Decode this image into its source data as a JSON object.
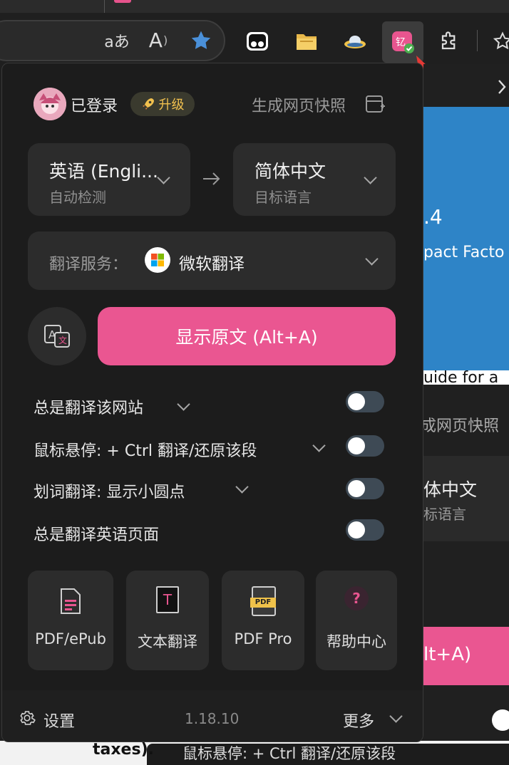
{
  "browser": {
    "read_aloud_label": "aあ",
    "read_aloud2_label": "A",
    "extensions": [
      "favorite-star",
      "glasses-extension",
      "folder-extension",
      "ufo-extension",
      "translate-extension",
      "extensions-puzzle"
    ]
  },
  "background_page": {
    "number_fragment": ".4",
    "impact_fragment": "pact Facto",
    "guide_fragment": "uide for a",
    "snapshot_fragment": "成网页快照",
    "target_lang_fragment": "体中文",
    "target_sub_fragment": "标语言",
    "button_fragment": "lt+A)",
    "taxes_fragment": "taxes).",
    "hover_fragment": "鼠标悬停:  + Ctrl 翻译/还原该段"
  },
  "popup": {
    "login_status": "已登录",
    "upgrade_label": "升级",
    "snapshot_label": "生成网页快照",
    "source_lang": {
      "name": "英语 (Engli...",
      "sub": "自动检测"
    },
    "target_lang": {
      "name": "简体中文",
      "sub": "目标语言"
    },
    "service": {
      "label": "翻译服务：",
      "value": "微软翻译"
    },
    "show_original_button": "显示原文 (Alt+A)",
    "options": [
      {
        "label": "总是翻译该网站",
        "has_dropdown": true,
        "enabled": false
      },
      {
        "label": "鼠标悬停:  + Ctrl 翻译/还原该段",
        "has_dropdown": true,
        "enabled": false
      },
      {
        "label": "划词翻译:  显示小圆点",
        "has_dropdown": true,
        "enabled": false
      },
      {
        "label": "总是翻译英语页面",
        "has_dropdown": false,
        "enabled": false
      }
    ],
    "tools": [
      {
        "label": "PDF/ePub",
        "icon": "pdf-file-icon"
      },
      {
        "label": "文本翻译",
        "icon": "text-translate-icon",
        "icon_text": "T"
      },
      {
        "label": "PDF Pro",
        "icon": "pdf-pro-icon",
        "icon_text": "PDF"
      },
      {
        "label": "帮助中心",
        "icon": "help-icon",
        "icon_text": "?"
      }
    ],
    "footer": {
      "settings_label": "设置",
      "version": "1.18.10",
      "more_label": "更多"
    }
  },
  "colors": {
    "accent_pink": "#ea5691",
    "toggle_off": "#3e4a55",
    "card_bg": "#2c2c2c",
    "popup_bg": "#1c1c1c",
    "star_blue": "#4a90d9"
  }
}
